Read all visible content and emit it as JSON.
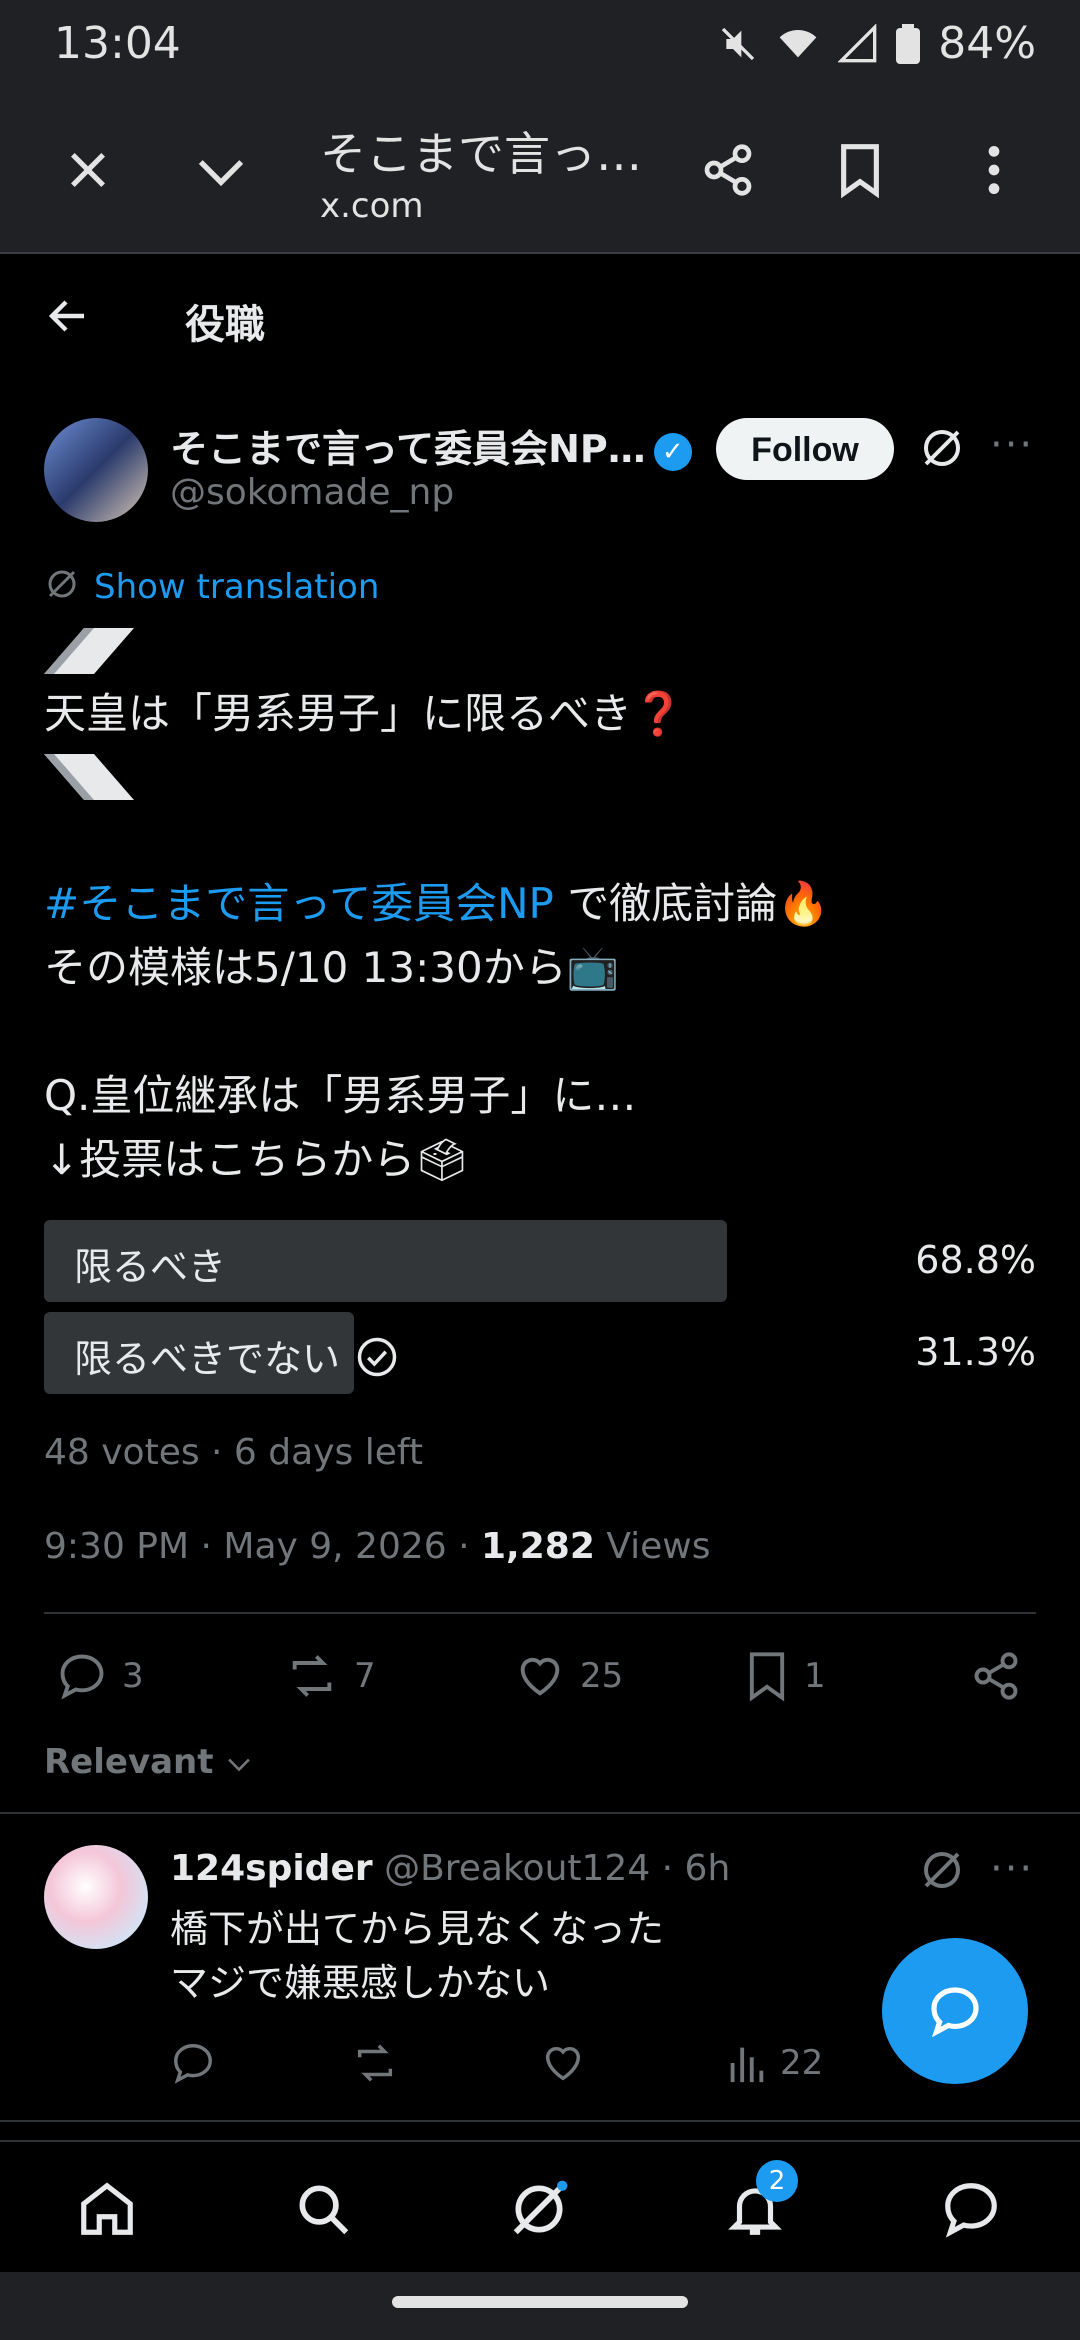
{
  "status": {
    "time": "13:04",
    "battery": "84%"
  },
  "browser": {
    "title": "そこまで言っ…",
    "url": "x.com"
  },
  "header": {
    "title": "役職"
  },
  "post": {
    "author_name": "そこまで言って委員会NP…",
    "handle": "@sokomade_np",
    "follow_label": "Follow",
    "show_translation": "Show translation",
    "line_question": "天皇は「男系男子」に限るべき❓",
    "hashtag": "#そこまで言って委員会NP",
    "line_debate_rest": " で徹底討論🔥",
    "line_time": "その模様は5/10 13:30から📺",
    "line_q": "Q.皇位継承は「男系男子」に…",
    "line_vote": "↓投票はこちらから🗳",
    "poll": [
      {
        "label": "限るべき",
        "pct": "68.8%",
        "fraction": 0.688,
        "selected": false
      },
      {
        "label": "限るべきでない",
        "pct": "31.3%",
        "fraction": 0.313,
        "selected": true
      }
    ],
    "votes": "48 votes · 6 days left",
    "timestamp": "9:30 PM · May 9, 2026 · ",
    "views_count": "1,282",
    "views_label": " Views",
    "replies": "3",
    "reposts": "7",
    "likes": "25",
    "bookmarks": "1"
  },
  "sort": {
    "label": "Relevant"
  },
  "reply": {
    "name": "124spider",
    "handle_time": "@Breakout124 · 6h",
    "line1": "橋下が出てから見なくなった",
    "line2": "マジで嫌悪感しかない",
    "views": "22"
  },
  "nav": {
    "notifications_badge": "2"
  },
  "colors": {
    "accent": "#1d9bf0",
    "background": "#000000"
  }
}
